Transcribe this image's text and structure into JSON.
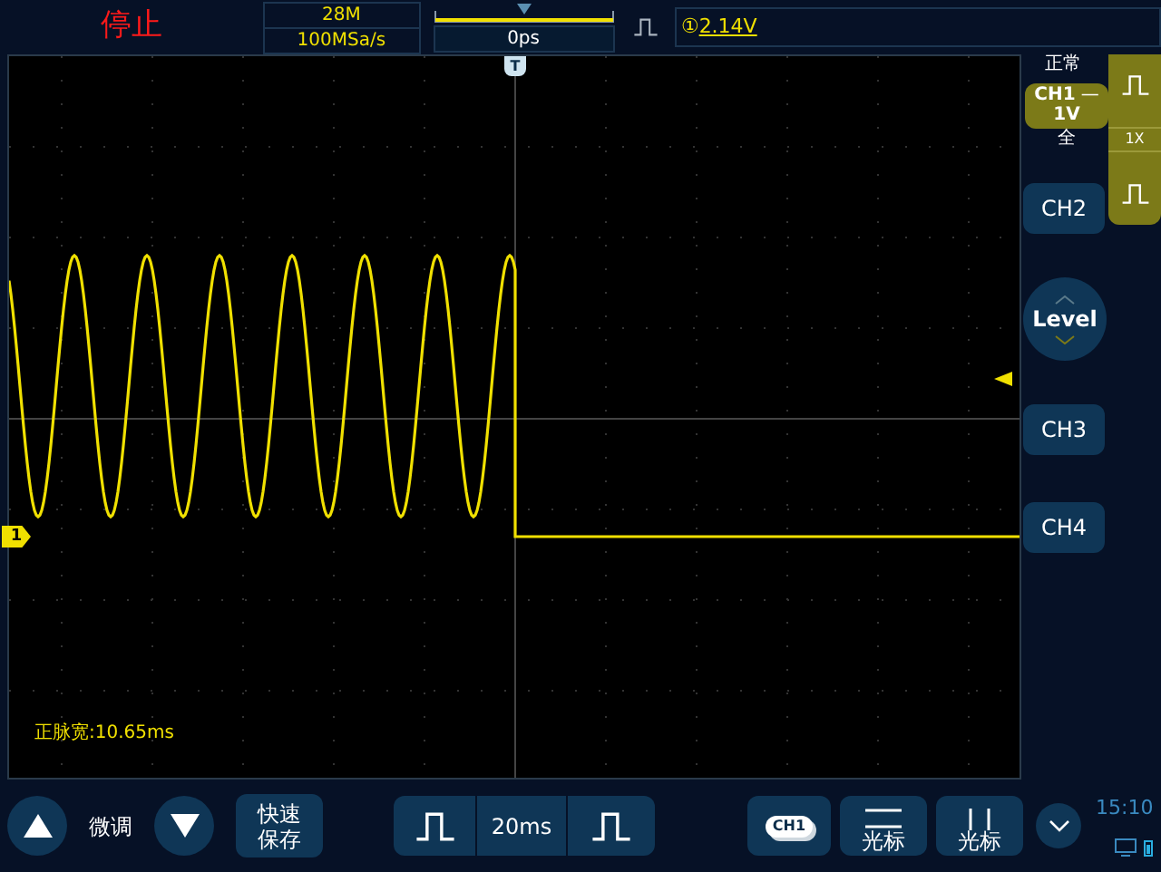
{
  "top_bar": {
    "status": "停止",
    "memory_depth": "28M",
    "sample_rate": "100MSa/s",
    "time_offset": "0ps",
    "trigger_source": "①",
    "trigger_level": "2.14V"
  },
  "plot": {
    "trigger_marker": "T",
    "channel_marker": "1",
    "measurement": "正脉宽:10.65ms"
  },
  "right_panel": {
    "acquire_mode": "正常",
    "ch1_label": "CH1",
    "ch1_coupling": "—",
    "ch1_scale": "1V",
    "bandwidth": "全",
    "probe": "1X",
    "buttons": [
      {
        "kind": "channel",
        "label": "CH2"
      },
      {
        "kind": "level",
        "label": "Level"
      },
      {
        "kind": "channel",
        "label": "CH3"
      },
      {
        "kind": "channel",
        "label": "CH4"
      }
    ]
  },
  "bottom_bar": {
    "fine_label": "微调",
    "quick_save": "快速保存",
    "timebase": "20ms",
    "cursor_channel": "CH1",
    "cursor_buttons": [
      "光标",
      "光标"
    ],
    "clock": "15:10"
  }
}
